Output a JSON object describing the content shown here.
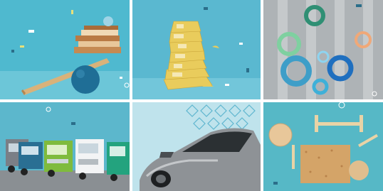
{
  "collage": {
    "tiles": [
      {
        "subject": "stacked-boxes-balance",
        "background": "#4fb9cf"
      },
      {
        "subject": "stacked-chip-bags",
        "background": "#5ab8d0"
      },
      {
        "subject": "tape-rolls-on-hooks",
        "background": "#aeb3b6"
      },
      {
        "subject": "trucks-in-lot",
        "background": "#5cb7cc"
      },
      {
        "subject": "silver-sports-car",
        "background": "#bfe3ec"
      },
      {
        "subject": "wood-spools-and-particleboard",
        "background": "#56b8c6"
      }
    ]
  }
}
